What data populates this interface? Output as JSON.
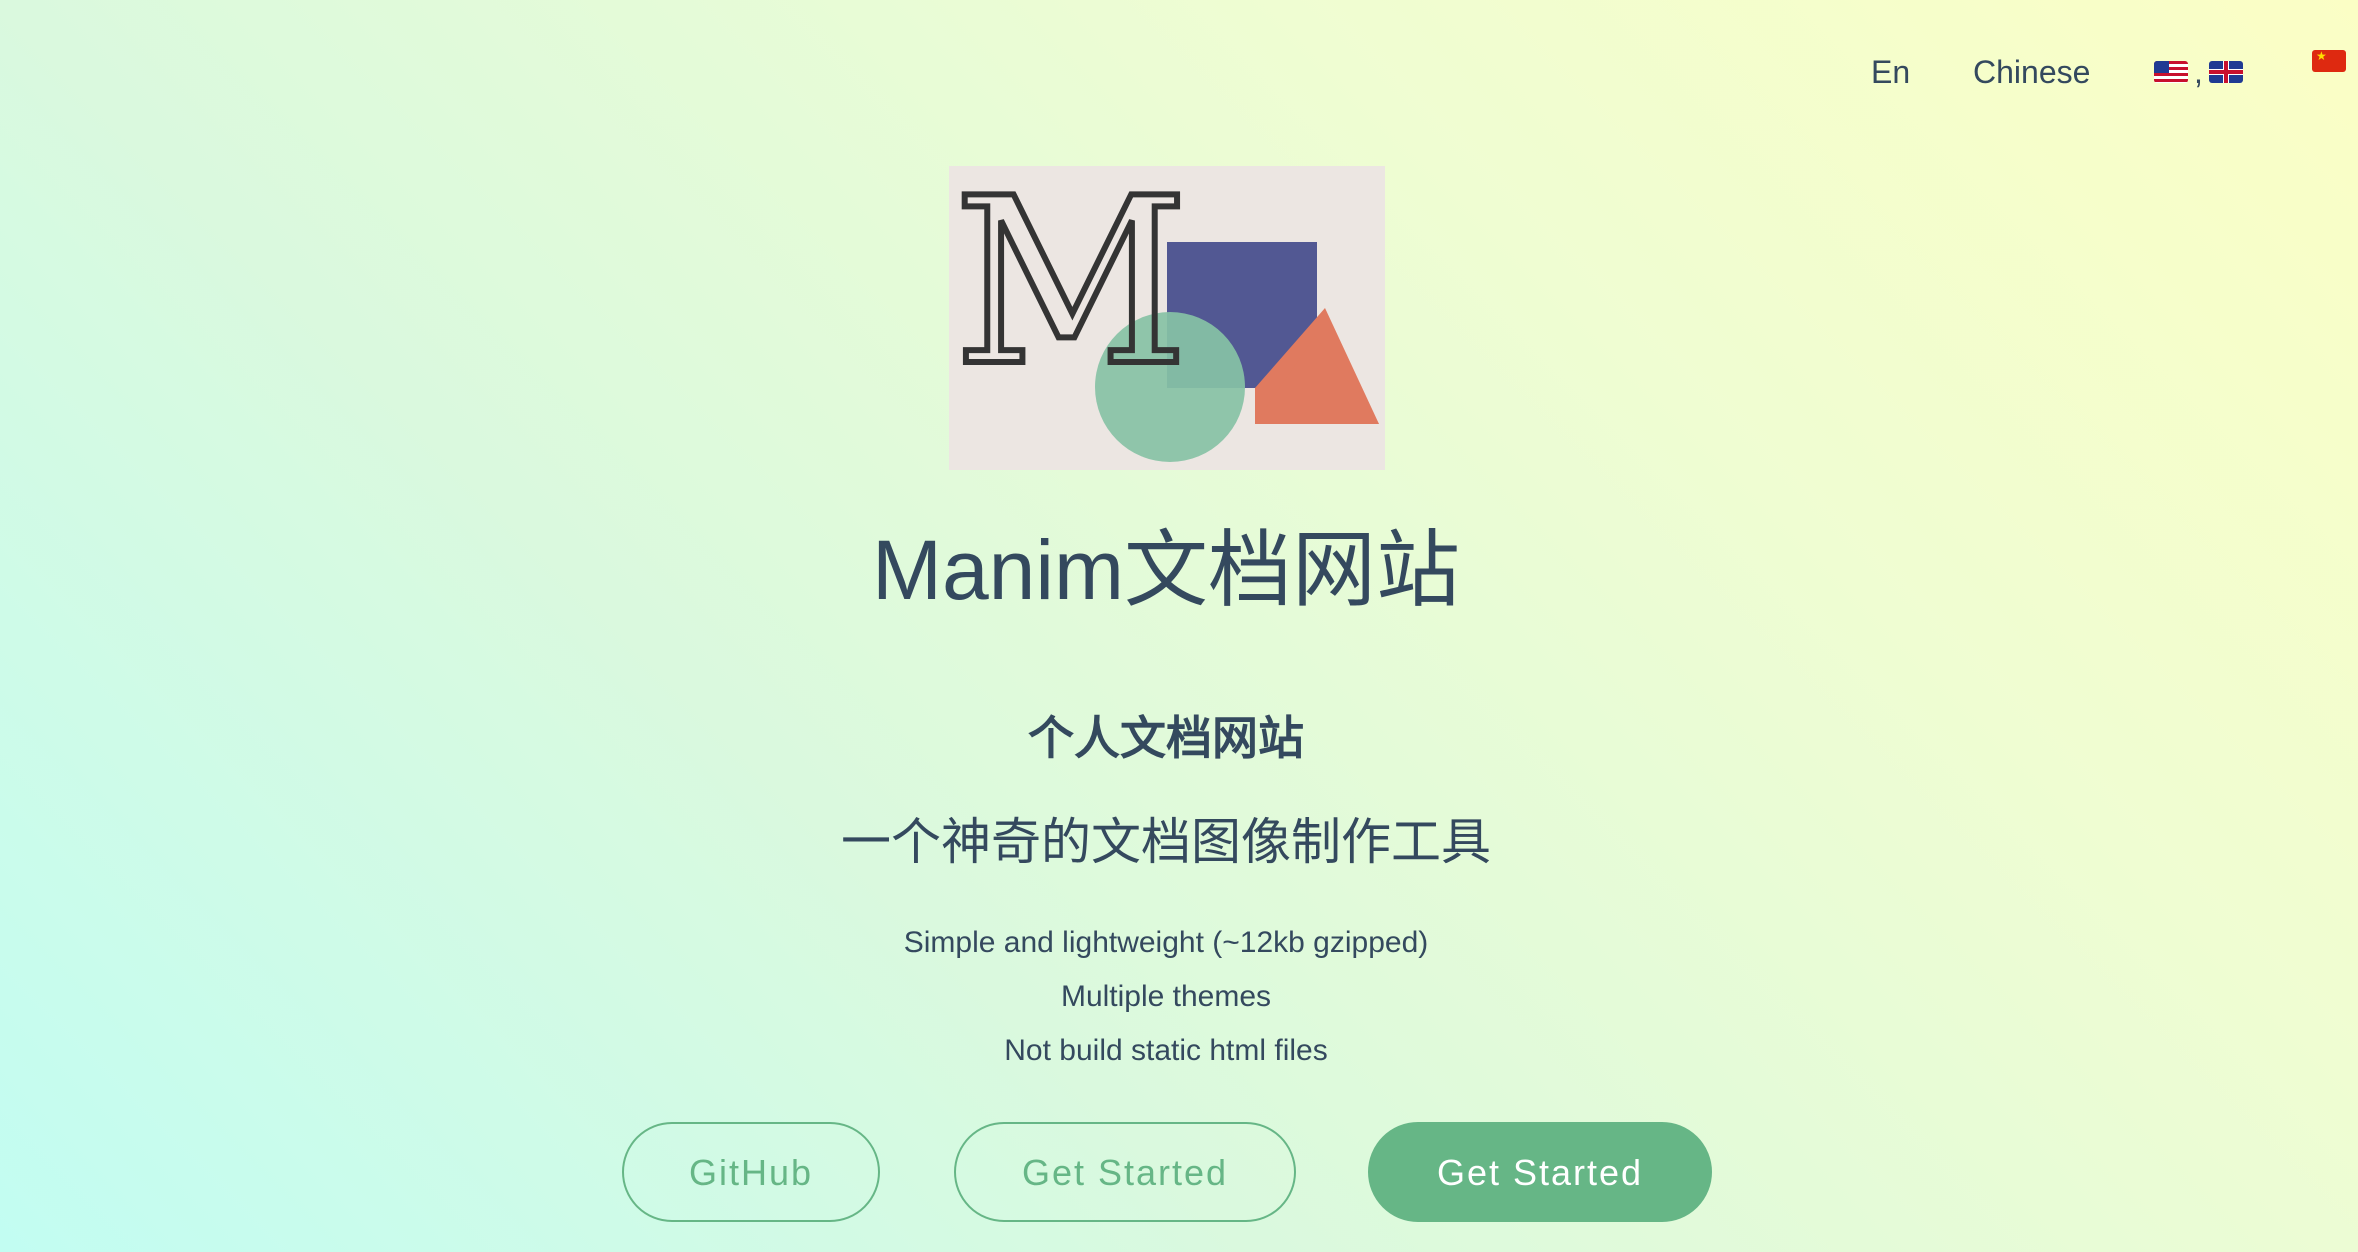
{
  "nav": {
    "items": [
      {
        "label": "En"
      },
      {
        "label": "Chinese"
      }
    ],
    "flags_separator": ","
  },
  "logo": {
    "letter": "M",
    "colors": {
      "background": "#ece6e2",
      "square": "#525893",
      "circle": "#87c2a5",
      "triangle": "#e07a5f",
      "letter": "#343434"
    }
  },
  "hero": {
    "title": "Manim文档网站",
    "subtitle": "个人文档网站",
    "tagline": "一个神奇的文档图像制作工具",
    "features": [
      "Simple and lightweight (~12kb gzipped)",
      "Multiple themes",
      "Not build static html files"
    ]
  },
  "buttons": {
    "github": "GitHub",
    "get_started_outline": "Get Started",
    "get_started_primary": "Get Started"
  },
  "colors": {
    "text": "#34495e",
    "accent": "#66b686"
  }
}
